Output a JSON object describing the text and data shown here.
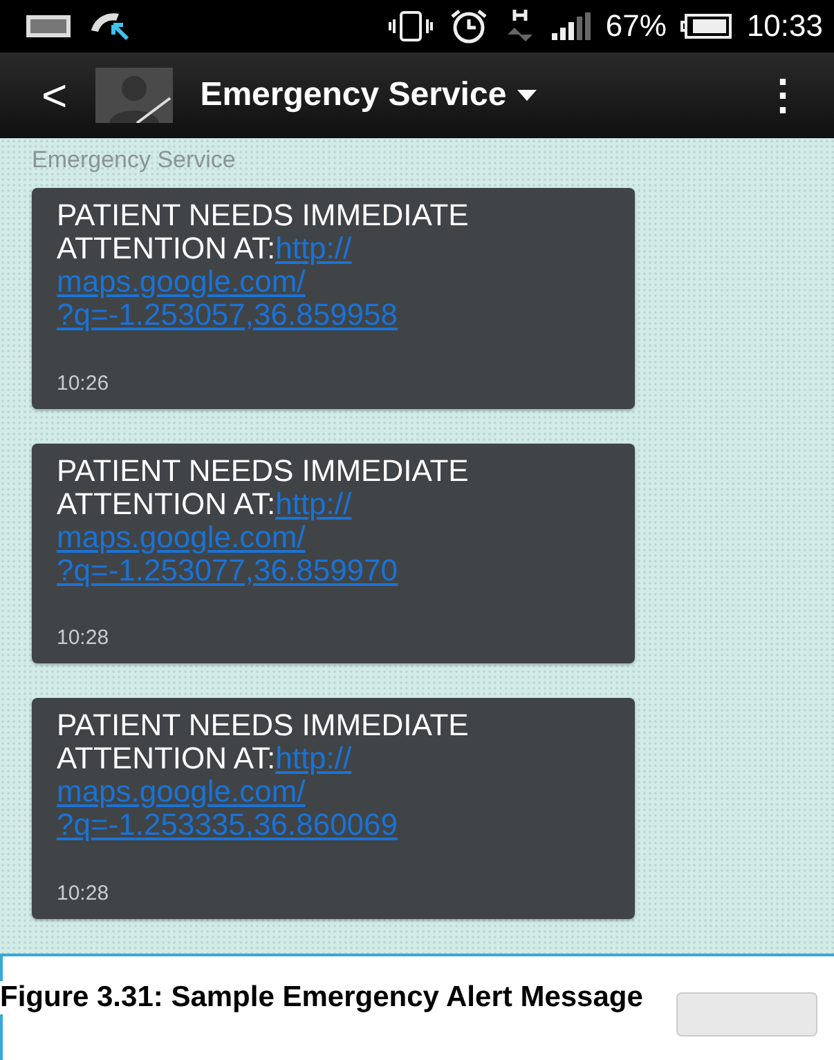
{
  "status_bar": {
    "battery_text": "67%",
    "time": "10:33"
  },
  "header": {
    "back": "<",
    "title": "Emergency Service",
    "menu": "⋮"
  },
  "thread": {
    "sender": "Emergency Service",
    "messages": [
      {
        "text": "PATIENT NEEDS IMMEDIATE ATTENTION AT:",
        "link_lines": [
          "http://",
          "maps.google.com/",
          "?q=-1.253057,36.859958"
        ],
        "time": "10:26"
      },
      {
        "text": "PATIENT NEEDS IMMEDIATE ATTENTION AT:",
        "link_lines": [
          "http://",
          "maps.google.com/",
          "?q=-1.253077,36.859970"
        ],
        "time": "10:28"
      },
      {
        "text": "PATIENT NEEDS IMMEDIATE ATTENTION AT:",
        "link_lines": [
          "http://",
          "maps.google.com/",
          "?q=-1.253335,36.860069"
        ],
        "time": "10:28"
      }
    ]
  },
  "caption": "Figure 3.31: Sample Emergency Alert Message"
}
